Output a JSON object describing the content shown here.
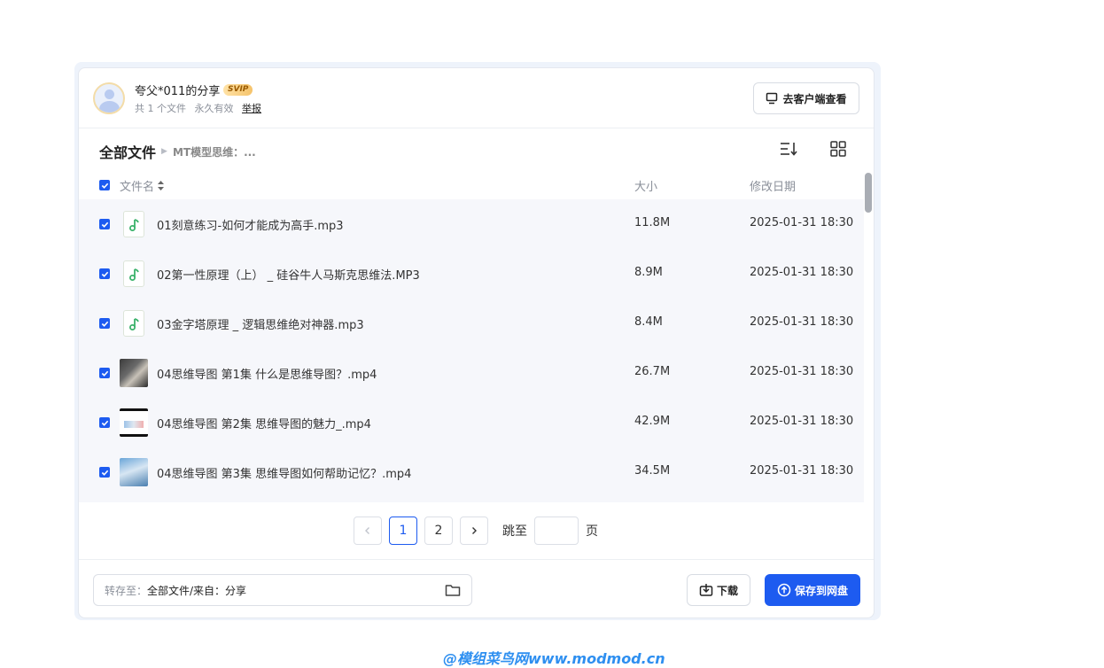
{
  "header": {
    "share_title": "夸父*011的分享",
    "vip_badge": "SVIP",
    "file_count": "共 1 个文件",
    "validity": "永久有效",
    "report": "举报",
    "client_button": "去客户端查看"
  },
  "breadcrumb": {
    "root": "全部文件",
    "current": "MT模型思维：..."
  },
  "columns": {
    "name": "文件名",
    "size": "大小",
    "date": "修改日期"
  },
  "files": [
    {
      "name": "01刻意练习-如何才能成为高手.mp3",
      "size": "11.8M",
      "date": "2025-01-31 18:30",
      "icon": "music-file-icon"
    },
    {
      "name": "02第一性原理（上） _ 硅谷牛人马斯克思维法.MP3",
      "size": "8.9M",
      "date": "2025-01-31 18:30",
      "icon": "music-file-icon"
    },
    {
      "name": "03金字塔原理 _ 逻辑思维绝对神器.mp3",
      "size": "8.4M",
      "date": "2025-01-31 18:30",
      "icon": "music-file-icon"
    },
    {
      "name": "04思维导图 第1集 什么是思维导图？.mp4",
      "size": "26.7M",
      "date": "2025-01-31 18:30",
      "icon": "video-thumbnail"
    },
    {
      "name": "04思维导图 第2集 思维导图的魅力_.mp4",
      "size": "42.9M",
      "date": "2025-01-31 18:30",
      "icon": "video-thumbnail"
    },
    {
      "name": "04思维导图 第3集 思维导图如何帮助记忆？.mp4",
      "size": "34.5M",
      "date": "2025-01-31 18:30",
      "icon": "video-thumbnail"
    }
  ],
  "pagination": {
    "pages": [
      "1",
      "2"
    ],
    "current": "1",
    "jump_label": "跳至",
    "page_suffix": "页"
  },
  "footer": {
    "save_label": "转存至：",
    "save_path": "全部文件/来自：分享",
    "download": "下载",
    "save_to_disk": "保存到网盘"
  },
  "watermark": "@模组菜鸟网www.modmod.cn",
  "colors": {
    "accent": "#1d5bf0",
    "row_bg": "#f6f7fb",
    "music_green": "#3bb26b"
  }
}
